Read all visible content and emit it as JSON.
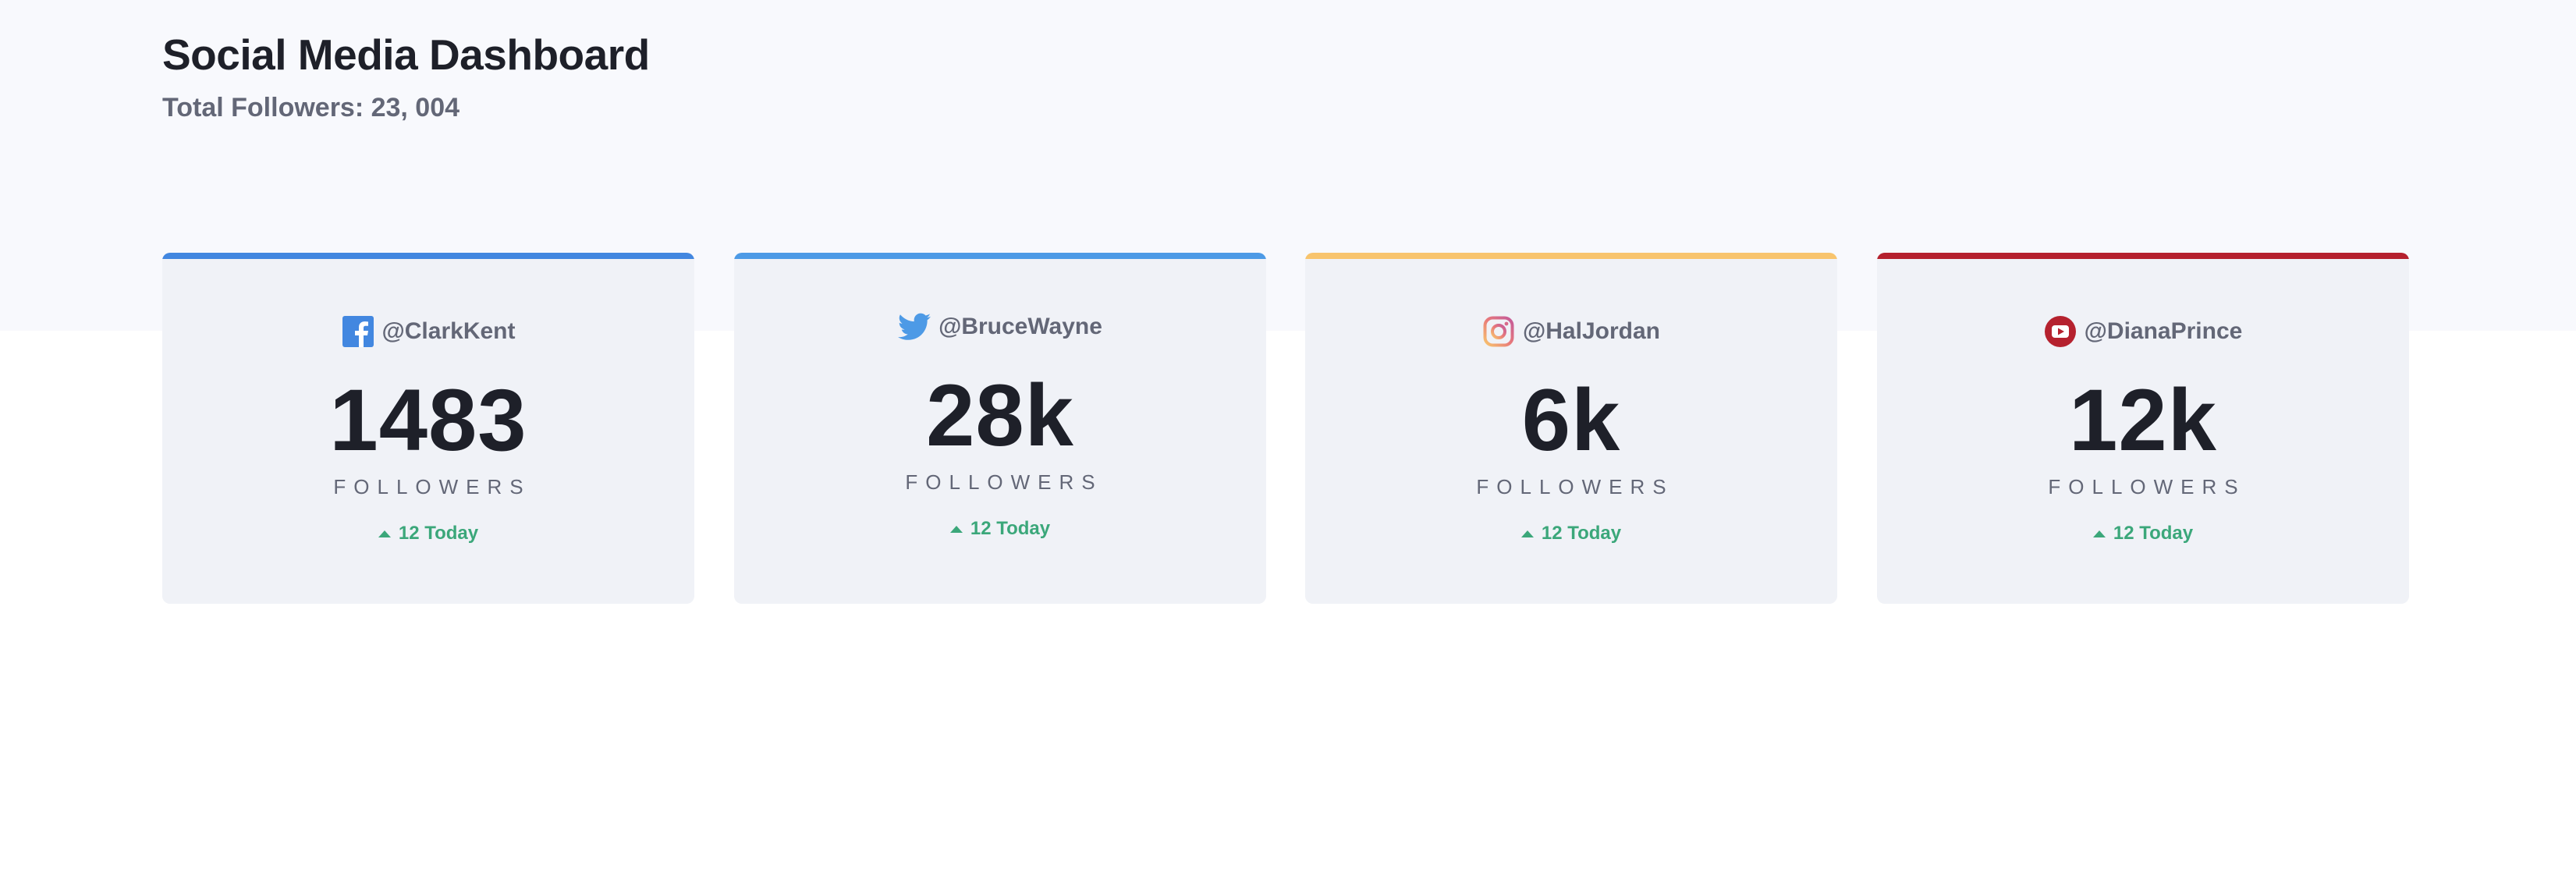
{
  "header": {
    "title": "Social Media Dashboard",
    "total_followers": "Total Followers: 23, 004"
  },
  "cards": [
    {
      "network": "facebook",
      "icon": "facebook-icon",
      "accent_color": "#4287e0",
      "handle": "@ClarkKent",
      "count": "1483",
      "label": "FOLLOWERS",
      "today": "12 Today"
    },
    {
      "network": "twitter",
      "icon": "twitter-icon",
      "accent_color": "#4d9ae6",
      "handle": "@BruceWayne",
      "count": "28k",
      "label": "FOLLOWERS",
      "today": "12 Today"
    },
    {
      "network": "instagram",
      "icon": "instagram-icon",
      "accent_color": "#f8c46d",
      "handle": "@HalJordan",
      "count": "6k",
      "label": "FOLLOWERS",
      "today": "12 Today"
    },
    {
      "network": "youtube",
      "icon": "youtube-icon",
      "accent_color": "#b5212e",
      "handle": "@DianaPrince",
      "count": "12k",
      "label": "FOLLOWERS",
      "today": "12 Today"
    }
  ],
  "colors": {
    "positive": "#3ba77a",
    "text_dark": "#1e2029",
    "text_muted": "#636777",
    "card_bg": "#f0f2f7",
    "top_band_bg": "#f8f9fd"
  }
}
